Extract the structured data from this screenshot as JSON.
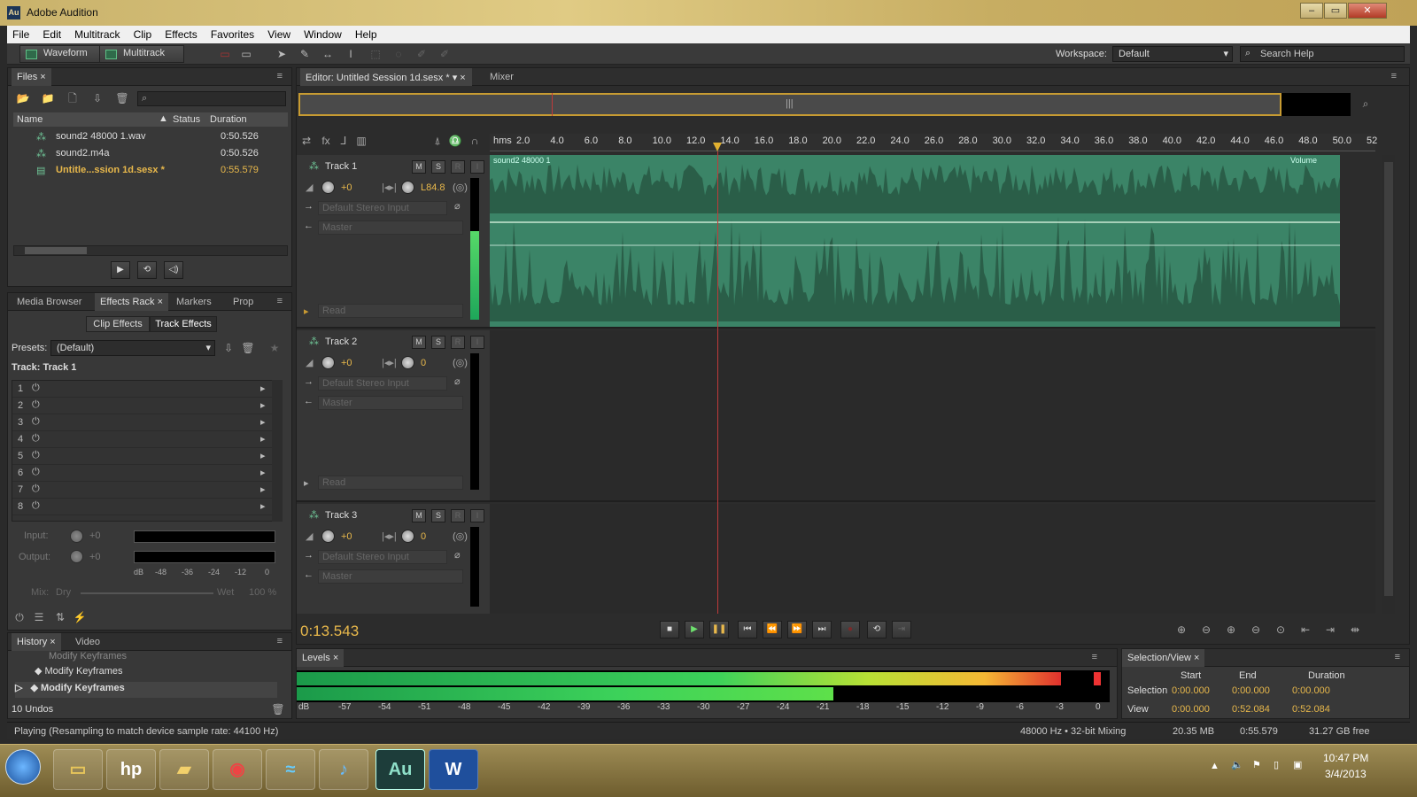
{
  "window": {
    "title": "Adobe Audition",
    "app_icon": "Au"
  },
  "menu": [
    "File",
    "Edit",
    "Multitrack",
    "Clip",
    "Effects",
    "Favorites",
    "View",
    "Window",
    "Help"
  ],
  "toolbar": {
    "waveform": "Waveform",
    "multitrack": "Multitrack",
    "workspace_label": "Workspace:",
    "workspace_value": "Default",
    "search_placeholder": "Search Help"
  },
  "files": {
    "tab": "Files",
    "columns": [
      "Name",
      "Status",
      "Duration"
    ],
    "rows": [
      {
        "name": "sound2 48000 1.wav",
        "duration": "0:50.526"
      },
      {
        "name": "sound2.m4a",
        "duration": "0:50.526"
      },
      {
        "name": "Untitle...ssion 1d.sesx *",
        "duration": "0:55.579"
      }
    ]
  },
  "effects": {
    "tabs": [
      "Media Browser",
      "Effects Rack",
      "Markers",
      "Prop"
    ],
    "subtabs": [
      "Clip Effects",
      "Track Effects"
    ],
    "presets_label": "Presets:",
    "presets_value": "(Default)",
    "track_label": "Track: Track 1",
    "slots": [
      "1",
      "2",
      "3",
      "4",
      "5",
      "6",
      "7",
      "8"
    ],
    "input_label": "Input:",
    "input_val": "+0",
    "output_label": "Output:",
    "output_val": "+0",
    "scale": [
      "dB",
      "-48",
      "-36",
      "-24",
      "-12",
      "0"
    ],
    "mix_label": "Mix:",
    "dry": "Dry",
    "wet": "Wet",
    "wet_pct": "100 %"
  },
  "history": {
    "tabs": [
      "History",
      "Video"
    ],
    "items": [
      "Modify Keyframes",
      "Modify Keyframes",
      "Modify Keyframes"
    ],
    "undos": "10 Undos"
  },
  "editor": {
    "tab": "Editor: Untitled Session 1d.sesx *",
    "mixer_tab": "Mixer",
    "ruler_unit": "hms",
    "ruler": [
      "2.0",
      "4.0",
      "6.0",
      "8.0",
      "10.0",
      "12.0",
      "14.0",
      "16.0",
      "18.0",
      "20.0",
      "22.0",
      "24.0",
      "26.0",
      "28.0",
      "30.0",
      "32.0",
      "34.0",
      "36.0",
      "38.0",
      "40.0",
      "42.0",
      "44.0",
      "46.0",
      "48.0",
      "50.0",
      "52"
    ],
    "clip_name": "sound2 48000 1",
    "clip_envelope": "Volume",
    "tracks": [
      {
        "name": "Track 1",
        "vol": "+0",
        "pan": "L84.8",
        "input": "Default Stereo Input",
        "output": "Master",
        "automation": "Read"
      },
      {
        "name": "Track 2",
        "vol": "+0",
        "pan": "0",
        "input": "Default Stereo Input",
        "output": "Master",
        "automation": "Read"
      },
      {
        "name": "Track 3",
        "vol": "+0",
        "pan": "0",
        "input": "Default Stereo Input",
        "output": "Master"
      }
    ],
    "track_buttons": [
      "M",
      "S",
      "R",
      "I"
    ],
    "time": "0:13.543"
  },
  "levels": {
    "tab": "Levels",
    "scale": [
      "dB",
      "-57",
      "-54",
      "-51",
      "-48",
      "-45",
      "-42",
      "-39",
      "-36",
      "-33",
      "-30",
      "-27",
      "-24",
      "-21",
      "-18",
      "-15",
      "-12",
      "-9",
      "-6",
      "-3",
      "0"
    ],
    "meter_fill_1": 0.94,
    "meter_fill_2": 0.66
  },
  "selview": {
    "tab": "Selection/View",
    "cols": [
      "Start",
      "End",
      "Duration"
    ],
    "selection_label": "Selection",
    "view_label": "View",
    "selection": [
      "0:00.000",
      "0:00.000",
      "0:00.000"
    ],
    "view": [
      "0:00.000",
      "0:52.084",
      "0:52.084"
    ]
  },
  "status": {
    "message": "Playing (Resampling to match device sample rate: 44100 Hz)",
    "format": "48000 Hz • 32-bit Mixing",
    "memory": "20.35 MB",
    "duration": "0:55.579",
    "free": "31.27 GB free"
  },
  "taskbar": {
    "time": "10:47 PM",
    "date": "3/4/2013"
  }
}
